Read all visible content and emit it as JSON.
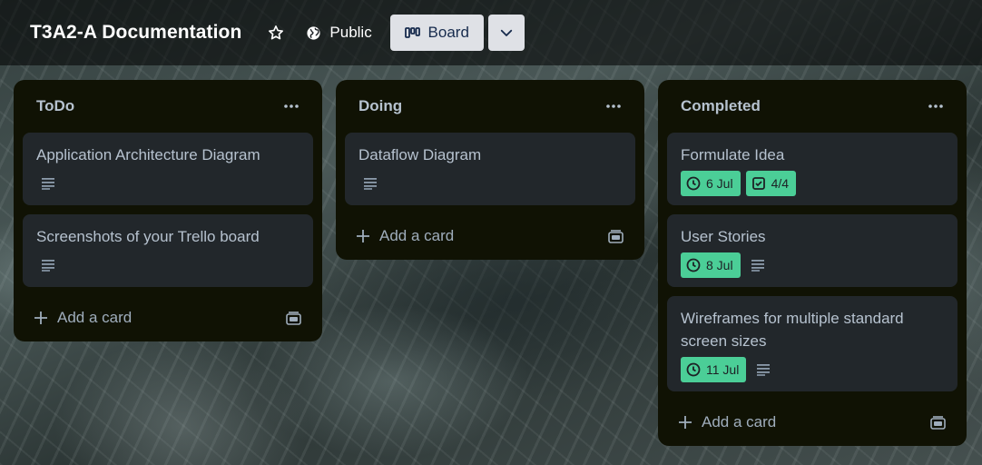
{
  "board": {
    "title": "T3A2-A Documentation",
    "visibility": "Public",
    "view_label": "Board"
  },
  "icons": {
    "star": "star-icon",
    "visibility": "globe-icon",
    "view": "board-view-icon",
    "dropdown": "chevron-down-icon",
    "more": "more-dots-icon",
    "description": "description-icon",
    "clock": "clock-icon",
    "checklist": "checklist-icon",
    "add": "plus-icon",
    "template": "card-template-icon"
  },
  "colors": {
    "list_bg": "#101204",
    "card_bg": "#22272b",
    "badge_green": "#4bce97",
    "text": "#b6c2cf"
  },
  "lists": [
    {
      "title": "ToDo",
      "add_label": "Add a card",
      "cards": [
        {
          "title": "Application Architecture Diagram"
        },
        {
          "title": "Screenshots of your Trello board"
        }
      ]
    },
    {
      "title": "Doing",
      "add_label": "Add a card",
      "cards": [
        {
          "title": "Dataflow Diagram"
        }
      ]
    },
    {
      "title": "Completed",
      "add_label": "Add a card",
      "cards": [
        {
          "title": "Formulate Idea",
          "due": "6 Jul",
          "checklist": "4/4"
        },
        {
          "title": "User Stories",
          "due": "8 Jul"
        },
        {
          "title": "Wireframes for multiple standard screen sizes",
          "due": "11 Jul"
        }
      ]
    }
  ]
}
